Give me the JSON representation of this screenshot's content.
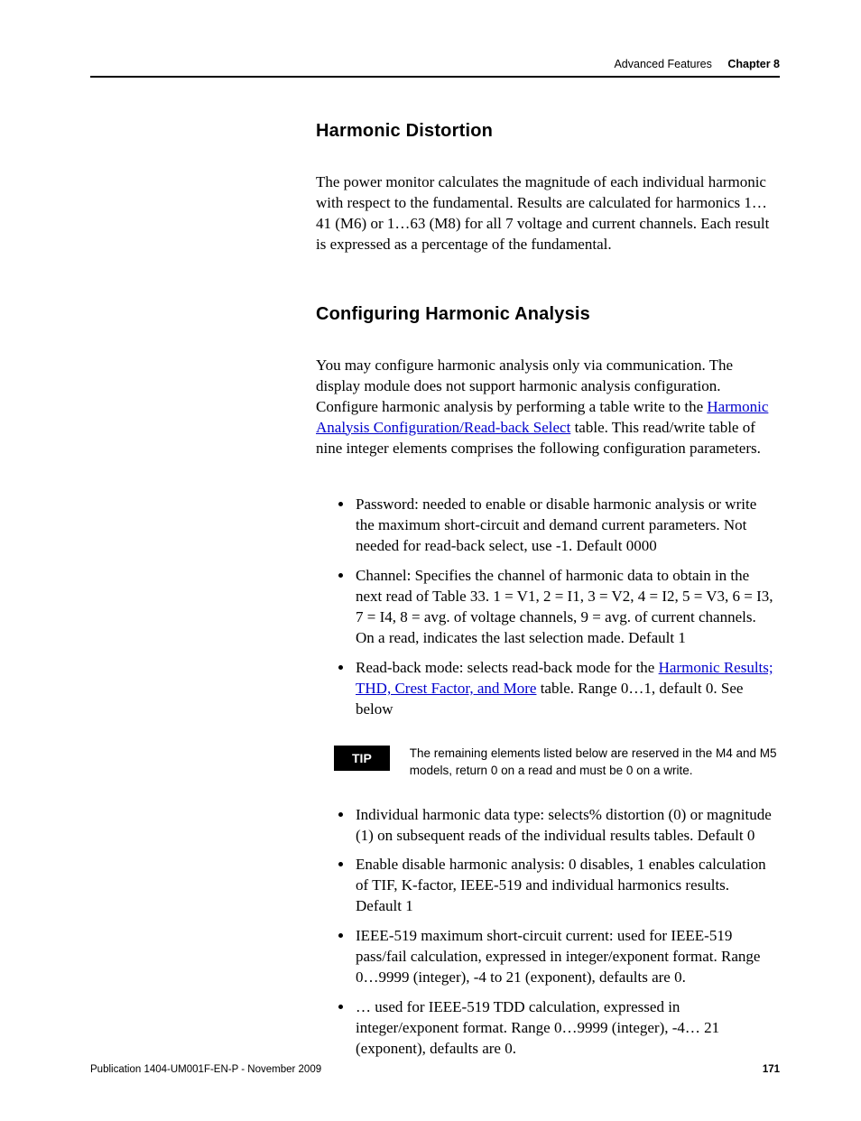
{
  "header": {
    "section": "Advanced Features",
    "chapter": "Chapter 8"
  },
  "h1": "Harmonic Distortion",
  "p1": "The power monitor calculates the magnitude of each individual harmonic with respect to the fundamental. Results are calculated for harmonics 1…41 (M6) or 1…63 (M8) for all 7 voltage and current channels. Each result is expressed as a percentage of the fundamental.",
  "h2": "Configuring Harmonic Analysis",
  "p2a": "You may configure harmonic analysis only via communication. The display module does not support harmonic analysis configuration. Configure harmonic analysis by performing a table write to the ",
  "p2link": "Harmonic Analysis Configuration/Read-back Select",
  "p2b": " table. This read/write table of nine integer elements comprises the following configuration parameters.",
  "list1": {
    "i1": "Password: needed to enable or disable harmonic analysis or write the maximum short-circuit and demand current parameters. Not needed for read-back select, use -1. Default 0000",
    "i2": "Channel: Specifies the channel of harmonic data to obtain in the next read of Table 33. 1 = V1, 2 = I1, 3 = V2, 4 = I2, 5 = V3, 6 = I3, 7 = I4, 8 = avg. of voltage channels, 9 = avg. of current channels. On a read, indicates the last selection made. Default 1",
    "i3a": "Read-back mode: selects read-back mode for the ",
    "i3link": "Harmonic Results; THD, Crest Factor, and More",
    "i3b": " table. Range 0…1, default 0. See below"
  },
  "tip": {
    "label": "TIP",
    "text": "The remaining elements listed below are reserved in the M4 and M5 models, return 0 on a read and must be 0 on a write."
  },
  "list2": {
    "i1": "Individual harmonic data type: selects% distortion (0) or magnitude (1) on subsequent reads of the individual results tables. Default 0",
    "i2": "Enable disable harmonic analysis: 0 disables, 1 enables calculation of TIF, K-factor, IEEE-519 and individual harmonics results. Default 1",
    "i3": "IEEE-519 maximum short-circuit current: used for IEEE-519 pass/fail calculation, expressed in integer/exponent format. Range 0…9999 (integer), -4 to 21 (exponent), defaults are 0.",
    "i4": "… used for IEEE-519 TDD calculation, expressed in integer/exponent format. Range 0…9999 (integer), -4… 21 (exponent), defaults are 0."
  },
  "footer": {
    "pub": "Publication 1404-UM001F-EN-P - November 2009",
    "page": "171"
  }
}
